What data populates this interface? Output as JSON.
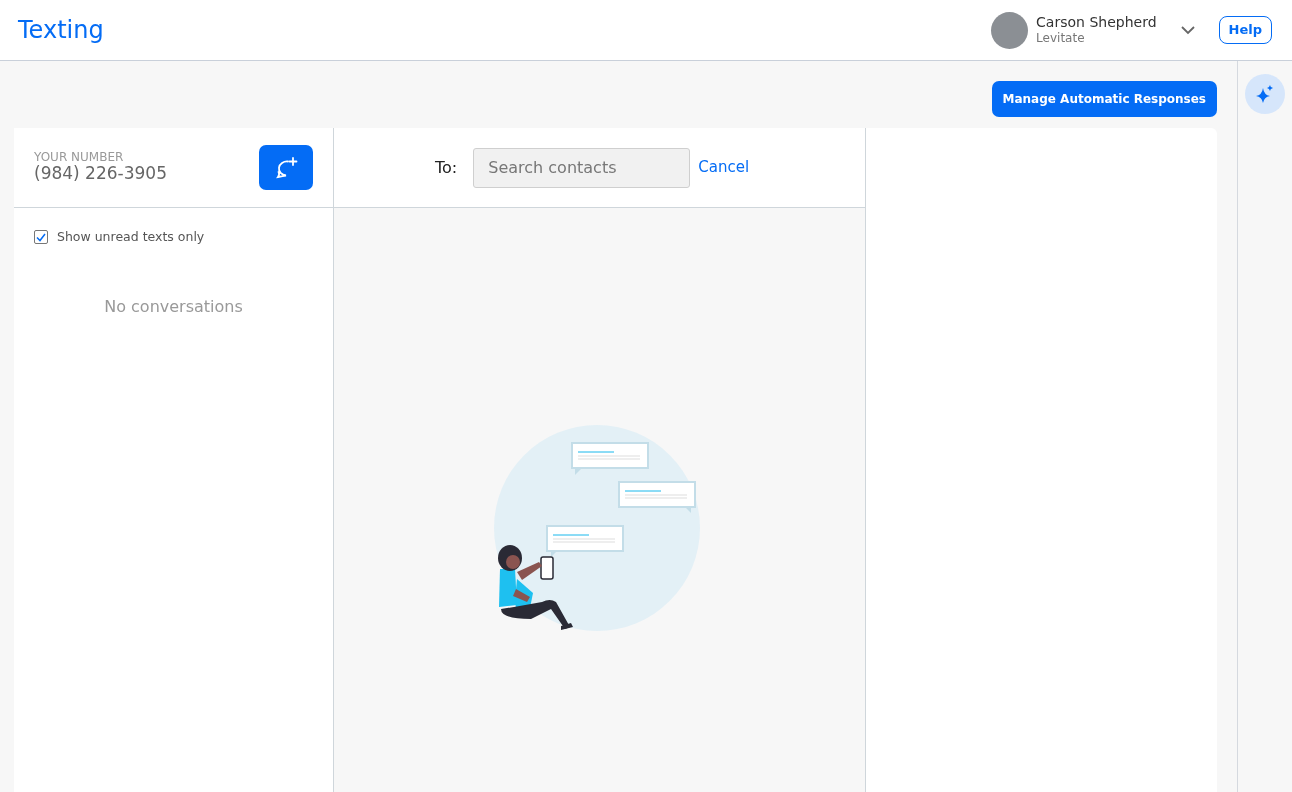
{
  "app": {
    "title": "Texting"
  },
  "user": {
    "name": "Carson Shepherd",
    "org": "Levitate"
  },
  "help_button": "Help",
  "manage_button": "Manage Automatic Responses",
  "your_number": {
    "label": "YOUR NUMBER",
    "value": "(984) 226-3905"
  },
  "filter": {
    "label": "Show unread texts only",
    "checked": true
  },
  "empty_state": "No conversations",
  "compose": {
    "to_label": "To:",
    "placeholder": "Search contacts",
    "cancel": "Cancel"
  }
}
